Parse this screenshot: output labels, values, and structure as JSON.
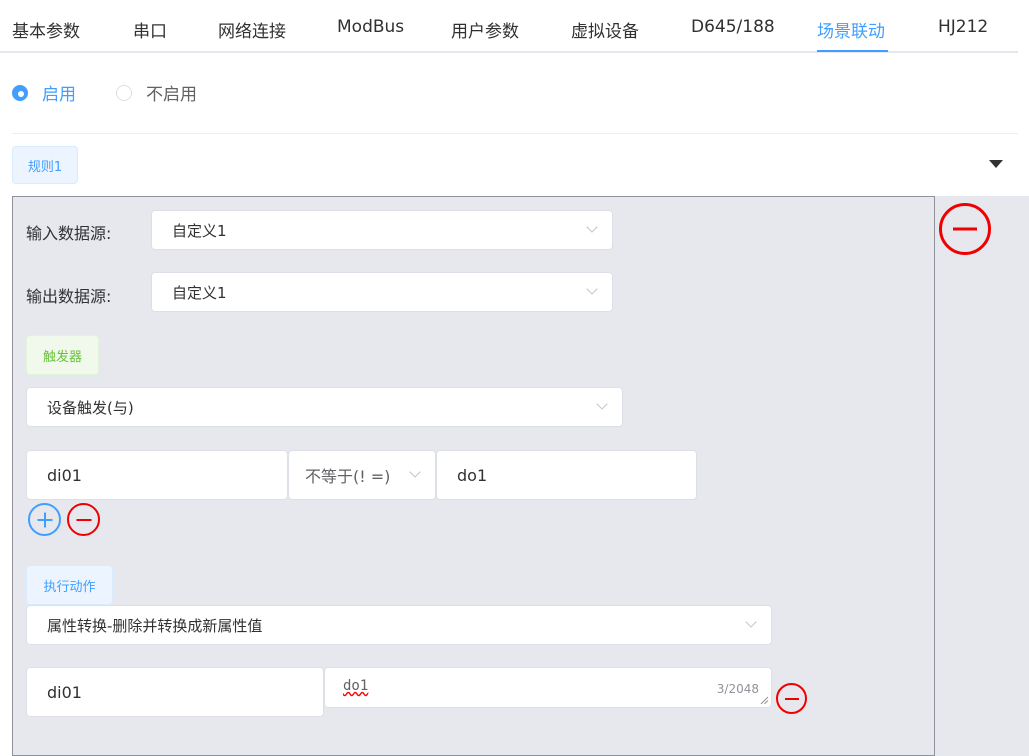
{
  "tabs": [
    "基本参数",
    "串口",
    "网络连接",
    "ModBus",
    "用户参数",
    "虚拟设备",
    "D645/188",
    "场景联动",
    "HJ212"
  ],
  "enable": {
    "on_label": "启用",
    "off_label": "不启用",
    "selected": "启用"
  },
  "rule": {
    "tag": "规则1",
    "input_source_label": "输入数据源:",
    "input_source_value": "自定义1",
    "output_source_label": "输出数据源:",
    "output_source_value": "自定义1",
    "trigger_tag": "触发器",
    "trigger_mode": "设备触发(与)",
    "condition": {
      "left": "di01",
      "operator": "不等于(! =)",
      "right": "do1"
    },
    "action_tag": "执行动作",
    "action_mode": "属性转换-删除并转换成新属性值",
    "action_row": {
      "field": "di01",
      "value": "do1",
      "counter": "3/2048"
    }
  },
  "colors": {
    "accent": "#409eff",
    "danger": "#f00000",
    "success": "#67c23a",
    "panel_bg": "#e6e8ee"
  },
  "icons": {
    "caret": "caret-down-icon",
    "remove": "minus-circle-icon",
    "add": "plus-circle-icon",
    "chevron": "chevron-down-icon"
  }
}
